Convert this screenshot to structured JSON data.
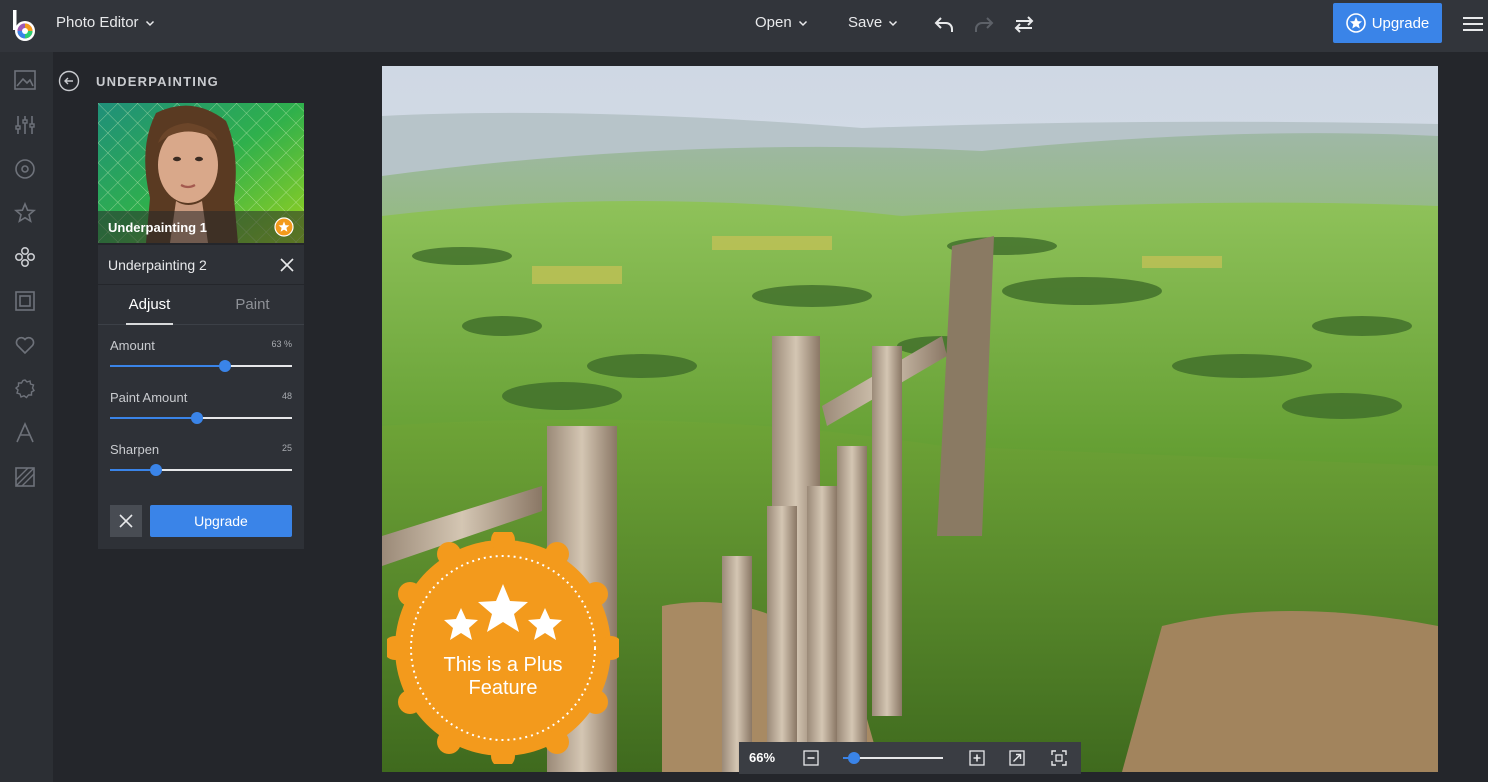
{
  "app": {
    "title": "Photo Editor"
  },
  "toolbar": {
    "open_label": "Open",
    "save_label": "Save",
    "upgrade_label": "Upgrade"
  },
  "sidebar": {
    "icons": [
      "image-icon",
      "sliders-icon",
      "eye-icon",
      "star-icon",
      "effects-icon",
      "frame-icon",
      "heart-icon",
      "texture-icon",
      "text-icon",
      "overlay-icon"
    ]
  },
  "panel": {
    "title": "UNDERPAINTING",
    "thumbnail_label": "Underpainting 1",
    "effect_name": "Underpainting 2",
    "tabs": [
      {
        "label": "Adjust"
      },
      {
        "label": "Paint"
      }
    ],
    "sliders": [
      {
        "label": "Amount",
        "value_text": "63 %",
        "value": 63
      },
      {
        "label": "Paint Amount",
        "value_text": "48",
        "value": 48
      },
      {
        "label": "Sharpen",
        "value_text": "25",
        "value": 25
      }
    ],
    "upgrade_label": "Upgrade"
  },
  "canvas": {
    "badge_line1": "This is a Plus",
    "badge_line2": "Feature",
    "zoom_text": "66%",
    "zoom_value": 66
  },
  "colors": {
    "accent": "#3a84e8",
    "badge": "#f39a1c"
  }
}
